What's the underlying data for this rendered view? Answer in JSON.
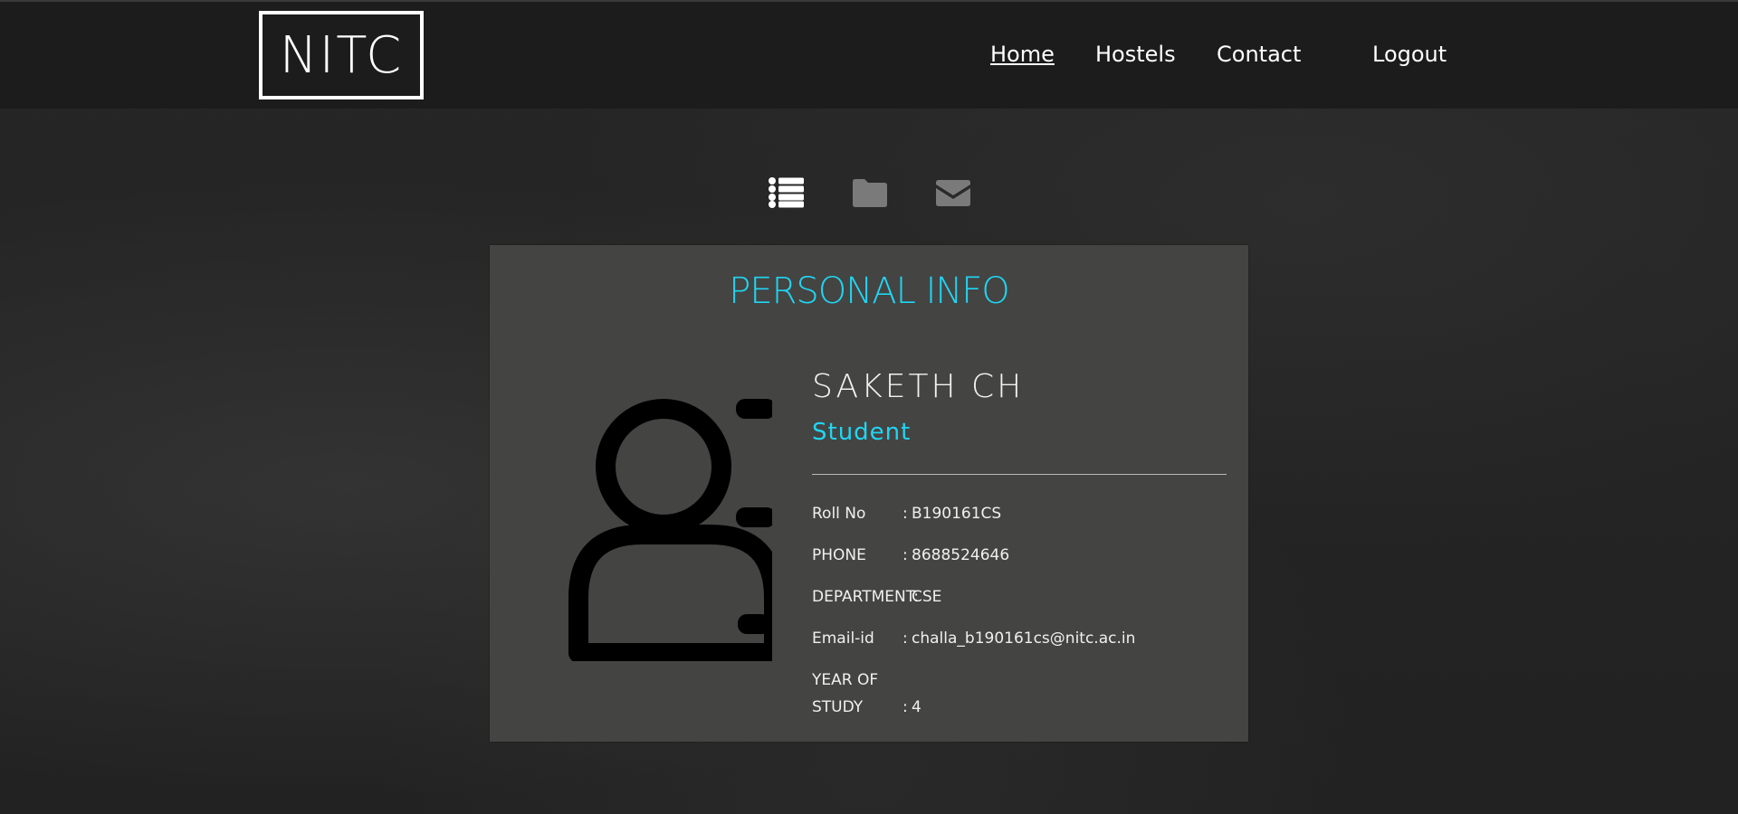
{
  "brand": {
    "logo_text": "NITC"
  },
  "nav": {
    "items": [
      {
        "label": "Home",
        "active": true
      },
      {
        "label": "Hostels",
        "active": false
      },
      {
        "label": "Contact",
        "active": false
      },
      {
        "label": "Logout",
        "active": false
      }
    ]
  },
  "tabs": [
    {
      "icon": "list-icon",
      "active": true
    },
    {
      "icon": "folder-icon",
      "active": false
    },
    {
      "icon": "envelope-icon",
      "active": false
    }
  ],
  "profile": {
    "section_title": "PERSONAL INFO",
    "avatar_icon": "user-avatar-icon",
    "name": "SAKETH CH",
    "role": "Student",
    "fields": [
      {
        "label": "Roll No",
        "separator": ":",
        "value": "B190161CS"
      },
      {
        "label": "PHONE",
        "separator": ":",
        "value": "8688524646"
      },
      {
        "label": "DEPARTMENT:",
        "separator": "",
        "value": "CSE"
      },
      {
        "label": "Email-id",
        "separator": ":",
        "value": "challa_b190161cs@nitc.ac.in"
      },
      {
        "label": "YEAR OF STUDY",
        "separator": ":",
        "value": "4"
      }
    ]
  },
  "colors": {
    "accent": "#1fd6f2",
    "navbar": "#1c1c1c",
    "card": "#444443",
    "background": "#262626"
  }
}
